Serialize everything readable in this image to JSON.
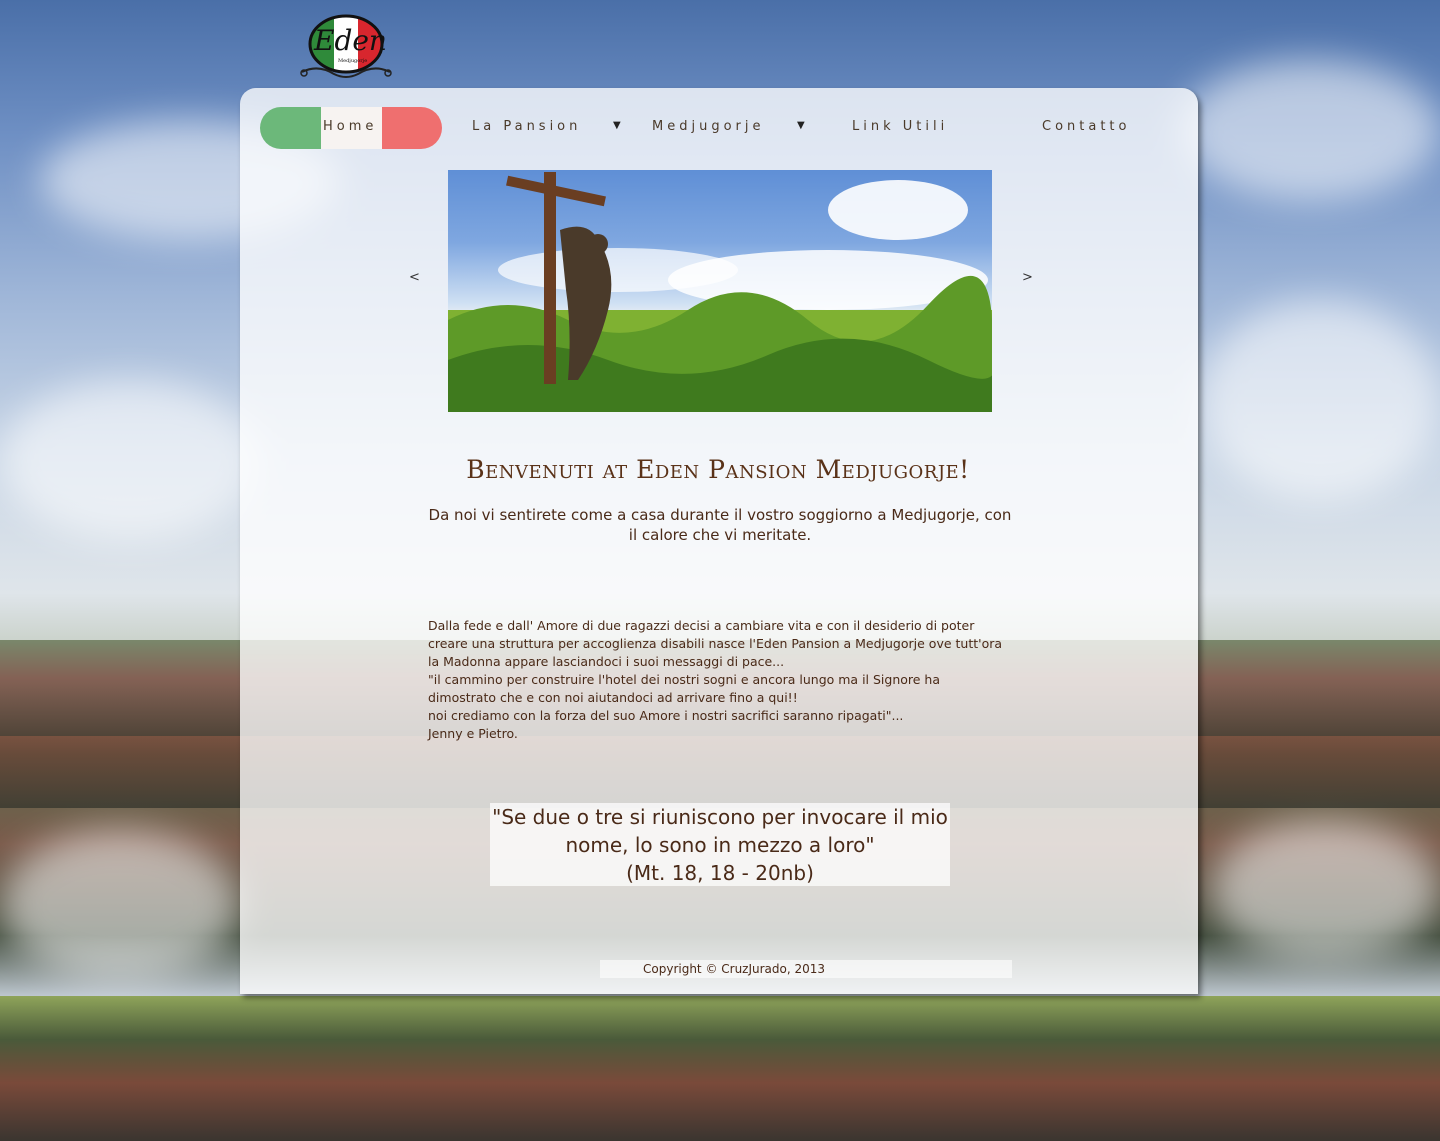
{
  "logo": {
    "text": "Eden",
    "subtext": "Medjugorje"
  },
  "nav": {
    "items": [
      {
        "label": "Home",
        "has_dropdown": false,
        "active": true
      },
      {
        "label": "La Pansion",
        "has_dropdown": true
      },
      {
        "label": "Medjugorje",
        "has_dropdown": true
      },
      {
        "label": "Link Utili",
        "has_dropdown": false
      },
      {
        "label": "Contatto",
        "has_dropdown": false
      }
    ]
  },
  "slider": {
    "prev_label": "<",
    "next_label": ">",
    "image_icon": "crucifix-photo"
  },
  "welcome": {
    "title": "Benvenuti at Eden Pansion Medjugorje!",
    "intro": "Da noi vi sentirete come a casa durante il vostro soggiorno a Medjugorje, con il calore che vi meritate."
  },
  "story": {
    "lines": [
      "Dalla fede e dall' Amore di due ragazzi decisi a cambiare vita e con il desiderio di poter",
      "creare una struttura per accoglienza disabili nasce l'Eden Pansion a Medjugorje ove tutt'ora",
      "la Madonna appare lasciandoci i suoi messaggi di pace...",
      "\"il cammino per construire l'hotel dei nostri sogni e ancora lungo ma il Signore ha",
      "dimostrato che e con noi aiutandoci ad arrivare fino a qui!!",
      "noi crediamo con la forza del suo Amore i nostri sacrifici saranno ripagati\"...",
      "Jenny e Pietro."
    ]
  },
  "quote": {
    "line1": "\"Se due o tre si riuniscono per invocare il mio",
    "line2": "nome, lo sono in mezzo a loro\"",
    "reference": "(Mt. 18, 18 - 20nb)"
  },
  "footer": {
    "copyright": "Copyright © CruzJurado, 2013"
  },
  "colors": {
    "flag_green": "#6cb87a",
    "flag_white": "#f7f3f1",
    "flag_red": "#ef6f6f",
    "text_brown": "#4a2a18",
    "title_brown": "#5a3218"
  }
}
